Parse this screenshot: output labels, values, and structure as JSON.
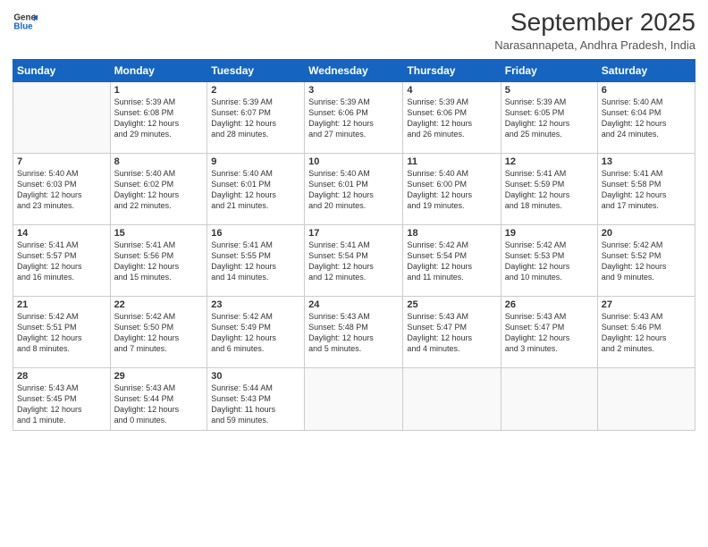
{
  "header": {
    "logo_line1": "General",
    "logo_line2": "Blue",
    "month": "September 2025",
    "location": "Narasannapeta, Andhra Pradesh, India"
  },
  "days_of_week": [
    "Sunday",
    "Monday",
    "Tuesday",
    "Wednesday",
    "Thursday",
    "Friday",
    "Saturday"
  ],
  "weeks": [
    [
      {
        "num": "",
        "info": ""
      },
      {
        "num": "1",
        "info": "Sunrise: 5:39 AM\nSunset: 6:08 PM\nDaylight: 12 hours\nand 29 minutes."
      },
      {
        "num": "2",
        "info": "Sunrise: 5:39 AM\nSunset: 6:07 PM\nDaylight: 12 hours\nand 28 minutes."
      },
      {
        "num": "3",
        "info": "Sunrise: 5:39 AM\nSunset: 6:06 PM\nDaylight: 12 hours\nand 27 minutes."
      },
      {
        "num": "4",
        "info": "Sunrise: 5:39 AM\nSunset: 6:06 PM\nDaylight: 12 hours\nand 26 minutes."
      },
      {
        "num": "5",
        "info": "Sunrise: 5:39 AM\nSunset: 6:05 PM\nDaylight: 12 hours\nand 25 minutes."
      },
      {
        "num": "6",
        "info": "Sunrise: 5:40 AM\nSunset: 6:04 PM\nDaylight: 12 hours\nand 24 minutes."
      }
    ],
    [
      {
        "num": "7",
        "info": "Sunrise: 5:40 AM\nSunset: 6:03 PM\nDaylight: 12 hours\nand 23 minutes."
      },
      {
        "num": "8",
        "info": "Sunrise: 5:40 AM\nSunset: 6:02 PM\nDaylight: 12 hours\nand 22 minutes."
      },
      {
        "num": "9",
        "info": "Sunrise: 5:40 AM\nSunset: 6:01 PM\nDaylight: 12 hours\nand 21 minutes."
      },
      {
        "num": "10",
        "info": "Sunrise: 5:40 AM\nSunset: 6:01 PM\nDaylight: 12 hours\nand 20 minutes."
      },
      {
        "num": "11",
        "info": "Sunrise: 5:40 AM\nSunset: 6:00 PM\nDaylight: 12 hours\nand 19 minutes."
      },
      {
        "num": "12",
        "info": "Sunrise: 5:41 AM\nSunset: 5:59 PM\nDaylight: 12 hours\nand 18 minutes."
      },
      {
        "num": "13",
        "info": "Sunrise: 5:41 AM\nSunset: 5:58 PM\nDaylight: 12 hours\nand 17 minutes."
      }
    ],
    [
      {
        "num": "14",
        "info": "Sunrise: 5:41 AM\nSunset: 5:57 PM\nDaylight: 12 hours\nand 16 minutes."
      },
      {
        "num": "15",
        "info": "Sunrise: 5:41 AM\nSunset: 5:56 PM\nDaylight: 12 hours\nand 15 minutes."
      },
      {
        "num": "16",
        "info": "Sunrise: 5:41 AM\nSunset: 5:55 PM\nDaylight: 12 hours\nand 14 minutes."
      },
      {
        "num": "17",
        "info": "Sunrise: 5:41 AM\nSunset: 5:54 PM\nDaylight: 12 hours\nand 12 minutes."
      },
      {
        "num": "18",
        "info": "Sunrise: 5:42 AM\nSunset: 5:54 PM\nDaylight: 12 hours\nand 11 minutes."
      },
      {
        "num": "19",
        "info": "Sunrise: 5:42 AM\nSunset: 5:53 PM\nDaylight: 12 hours\nand 10 minutes."
      },
      {
        "num": "20",
        "info": "Sunrise: 5:42 AM\nSunset: 5:52 PM\nDaylight: 12 hours\nand 9 minutes."
      }
    ],
    [
      {
        "num": "21",
        "info": "Sunrise: 5:42 AM\nSunset: 5:51 PM\nDaylight: 12 hours\nand 8 minutes."
      },
      {
        "num": "22",
        "info": "Sunrise: 5:42 AM\nSunset: 5:50 PM\nDaylight: 12 hours\nand 7 minutes."
      },
      {
        "num": "23",
        "info": "Sunrise: 5:42 AM\nSunset: 5:49 PM\nDaylight: 12 hours\nand 6 minutes."
      },
      {
        "num": "24",
        "info": "Sunrise: 5:43 AM\nSunset: 5:48 PM\nDaylight: 12 hours\nand 5 minutes."
      },
      {
        "num": "25",
        "info": "Sunrise: 5:43 AM\nSunset: 5:47 PM\nDaylight: 12 hours\nand 4 minutes."
      },
      {
        "num": "26",
        "info": "Sunrise: 5:43 AM\nSunset: 5:47 PM\nDaylight: 12 hours\nand 3 minutes."
      },
      {
        "num": "27",
        "info": "Sunrise: 5:43 AM\nSunset: 5:46 PM\nDaylight: 12 hours\nand 2 minutes."
      }
    ],
    [
      {
        "num": "28",
        "info": "Sunrise: 5:43 AM\nSunset: 5:45 PM\nDaylight: 12 hours\nand 1 minute."
      },
      {
        "num": "29",
        "info": "Sunrise: 5:43 AM\nSunset: 5:44 PM\nDaylight: 12 hours\nand 0 minutes."
      },
      {
        "num": "30",
        "info": "Sunrise: 5:44 AM\nSunset: 5:43 PM\nDaylight: 11 hours\nand 59 minutes."
      },
      {
        "num": "",
        "info": ""
      },
      {
        "num": "",
        "info": ""
      },
      {
        "num": "",
        "info": ""
      },
      {
        "num": "",
        "info": ""
      }
    ]
  ]
}
